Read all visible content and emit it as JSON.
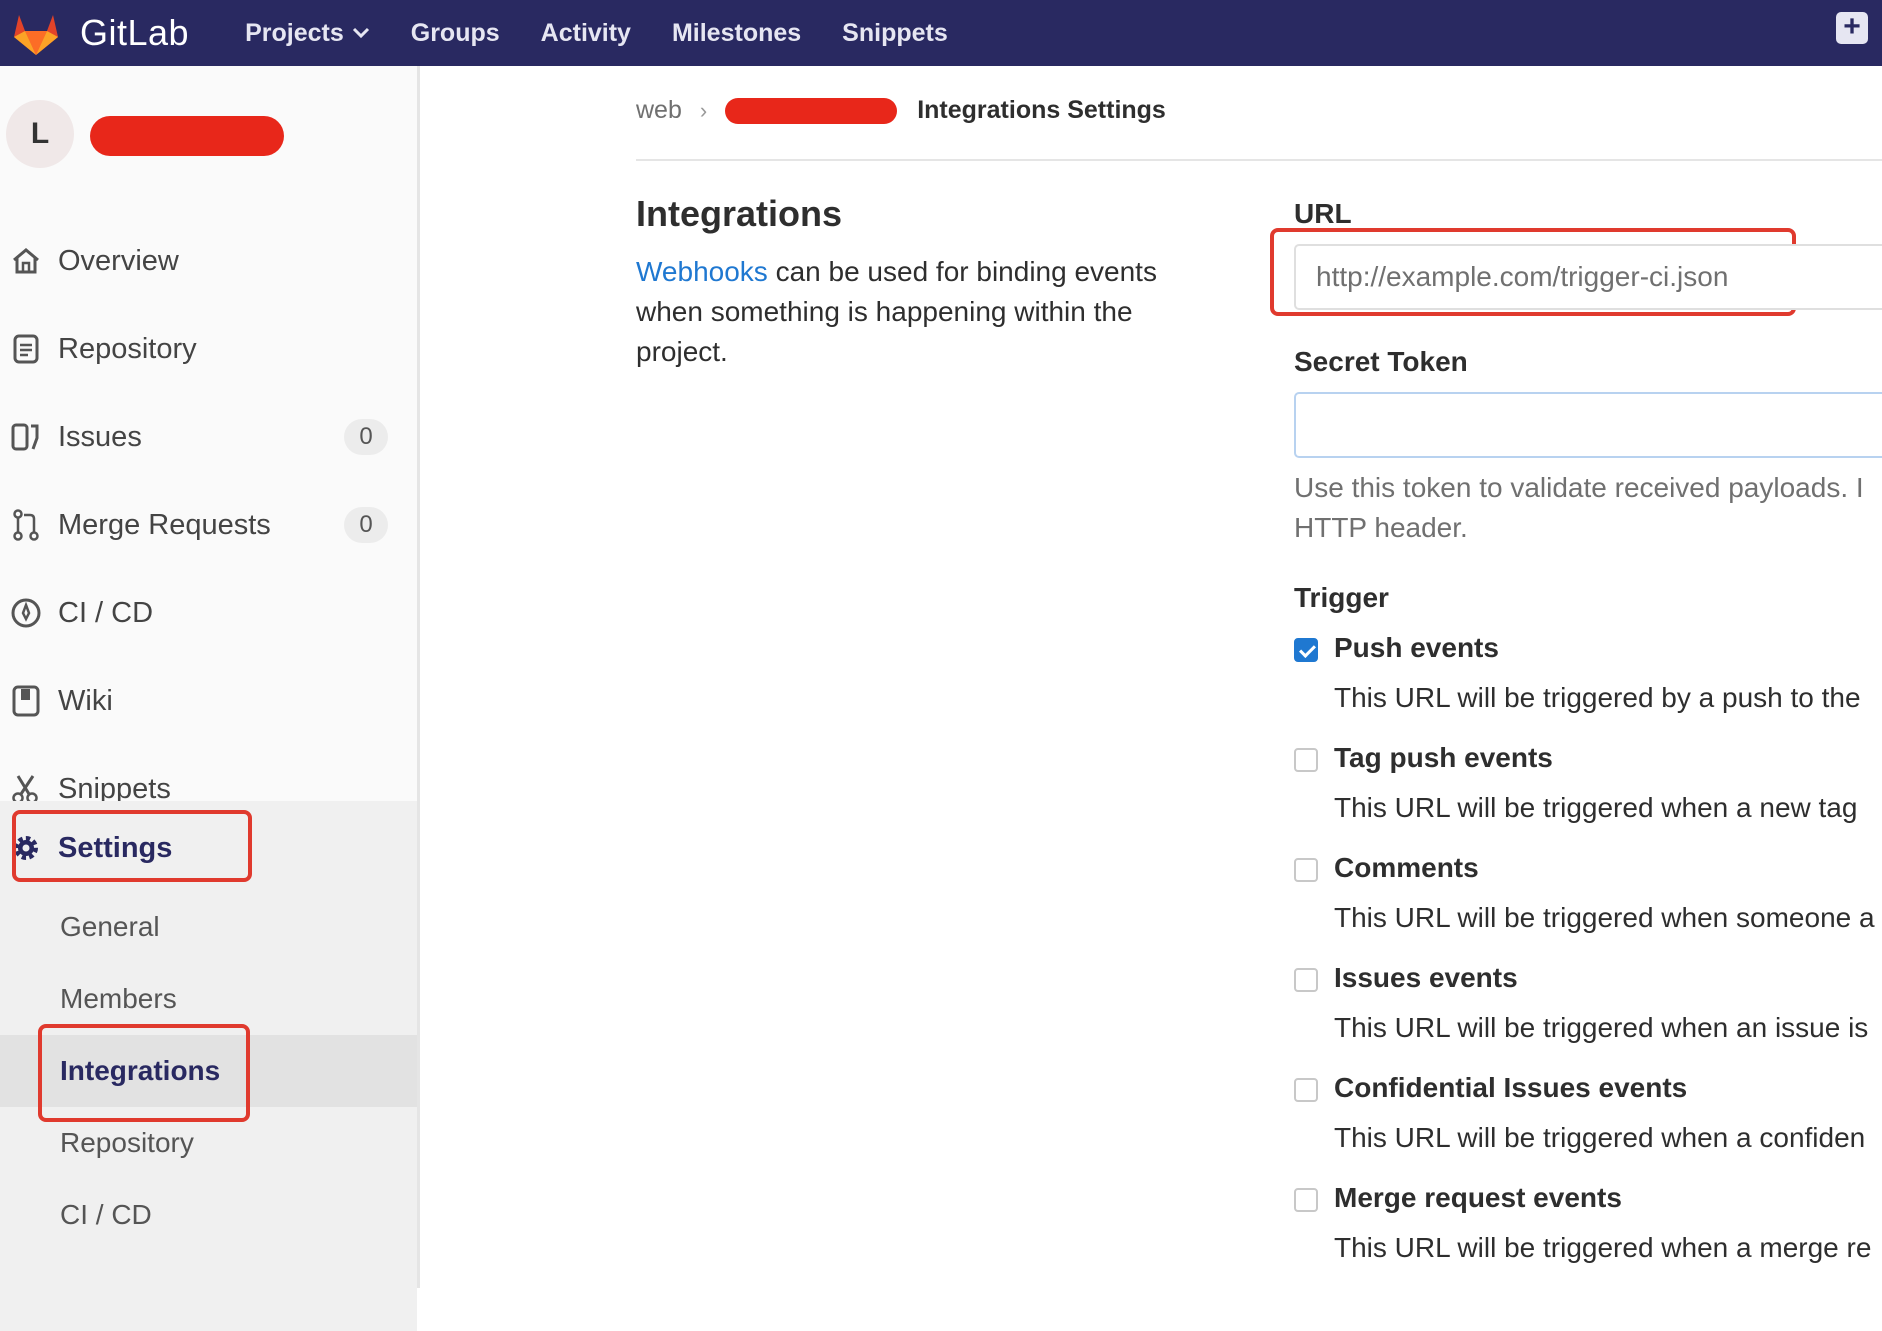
{
  "navbar": {
    "brand": "GitLab",
    "links": [
      "Projects",
      "Groups",
      "Activity",
      "Milestones",
      "Snippets"
    ],
    "plus": "+",
    "background": "#292961"
  },
  "sidebar": {
    "avatar_letter": "L",
    "items": [
      {
        "label": "Overview",
        "icon": "home-icon"
      },
      {
        "label": "Repository",
        "icon": "doc-icon"
      },
      {
        "label": "Issues",
        "icon": "issues-icon",
        "count": "0"
      },
      {
        "label": "Merge Requests",
        "icon": "merge-request-icon",
        "count": "0"
      },
      {
        "label": "CI / CD",
        "icon": "rocket-icon"
      },
      {
        "label": "Wiki",
        "icon": "book-icon"
      },
      {
        "label": "Snippets",
        "icon": "scissors-icon"
      },
      {
        "label": "Settings",
        "icon": "gear-icon"
      }
    ],
    "settings_sub": [
      "General",
      "Members",
      "Integrations",
      "Repository",
      "CI / CD"
    ]
  },
  "breadcrumb": {
    "root": "web",
    "separator": "›",
    "current": "Integrations Settings"
  },
  "intro": {
    "title": "Integrations",
    "link_text": "Webhooks",
    "text": " can be used for binding events when something is happening within the project."
  },
  "form": {
    "url_label": "URL",
    "url_placeholder": "http://example.com/trigger-ci.json",
    "secret_label": "Secret Token",
    "secret_value": "",
    "secret_help_line1": "Use this token to validate received payloads. I",
    "secret_help_line2": "HTTP header.",
    "trigger_label": "Trigger",
    "triggers": [
      {
        "label": "Push events",
        "checked": true,
        "desc": "This URL will be triggered by a push to the"
      },
      {
        "label": "Tag push events",
        "checked": false,
        "desc": "This URL will be triggered when a new tag"
      },
      {
        "label": "Comments",
        "checked": false,
        "desc": "This URL will be triggered when someone a"
      },
      {
        "label": "Issues events",
        "checked": false,
        "desc": "This URL will be triggered when an issue is"
      },
      {
        "label": "Confidential Issues events",
        "checked": false,
        "desc": "This URL will be triggered when a confiden"
      },
      {
        "label": "Merge request events",
        "checked": false,
        "desc": "This URL will be triggered when a merge re"
      }
    ]
  },
  "colors": {
    "accent": "#1f78d1",
    "annotation_red": "#e03a2e",
    "redaction_red": "#e8271a"
  }
}
